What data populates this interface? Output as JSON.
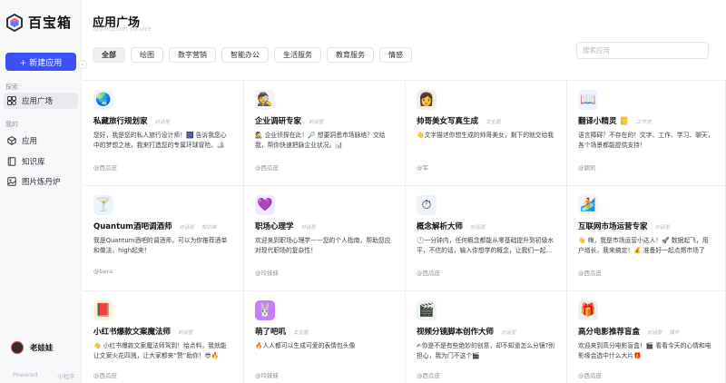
{
  "app": {
    "name": "百宝箱"
  },
  "sidebar": {
    "new_button": "+ 新建应用",
    "explore_label": "探索",
    "my_label": "我的",
    "items": [
      {
        "label": "应用广场",
        "icon": "grid-icon"
      },
      {
        "label": "应用",
        "icon": "box-icon"
      },
      {
        "label": "知识库",
        "icon": "book-icon"
      },
      {
        "label": "图片炼丹炉",
        "icon": "image-icon"
      }
    ],
    "user": {
      "name": "老娃娃"
    },
    "footer": {
      "powered": "Powered",
      "mini": "小程序"
    }
  },
  "header": {
    "title": "应用广场",
    "subtitle": "application square",
    "search_placeholder": "搜索应用",
    "tabs": [
      "全部",
      "绘图",
      "数字营销",
      "智能办公",
      "生活服务",
      "教育服务",
      "情感"
    ]
  },
  "cards": [
    {
      "name": "私藏旅行规划家",
      "tag": "对话型",
      "desc": "您好，我是您的私人旅行设计师！🎆 告诉我您心中的梦想之地，我来打造您的专属环球冒险。🏕✨",
      "author": "@西瓜皮",
      "icon": "globe-icon",
      "glyph": "🌏",
      "bg": "#eef6ff"
    },
    {
      "name": "企业调研专家",
      "tag": "对话型",
      "desc": "🕵 企业侦探在此！🔎 想要洞悉市场脉络？交给我，帮你快速把脉企业状况。📊",
      "author": "@西瓜皮",
      "icon": "detective-icon",
      "glyph": "🕵",
      "bg": "#f4f4f4"
    },
    {
      "name": "帅哥美女写真生成",
      "tag": "文生图",
      "desc": "👋文字描述你想生成的帅哥美女，剩下的就交给我",
      "author": "@军",
      "icon": "portrait-icon",
      "glyph": "👩",
      "bg": "#f6ece6"
    },
    {
      "name": "翻译小精灵 📒",
      "tag": "工作流",
      "desc": "语言障碍？不存在的！文字、工作、学习、聊天，各个场景都能提供支持！",
      "author": "@颖凯",
      "icon": "translate-icon",
      "glyph": "📖",
      "bg": "#eaf3ff"
    },
    {
      "name": "Quantum酒吧调酒师",
      "tag": "对话型",
      "tag2": "知识库",
      "desc": "我是Quantum酒吧的调酒师，可以为你推荐酒单和做法，high起来！",
      "author": "@bera",
      "icon": "cocktail-icon",
      "glyph": "🍸",
      "bg": "#e8f6fb"
    },
    {
      "name": "职场心理学",
      "tag": "对话型",
      "desc": "欢迎来到职场心理学——您的个人指南，帮助您应对现代职场的复杂性！",
      "author": "@玲妹妹",
      "icon": "heart-icon",
      "glyph": "💜",
      "bg": "#efe9ff"
    },
    {
      "name": "概念解析大师",
      "tag": "对话型",
      "desc": "🕛一分钟内，任何概念都能从零基础提升到初级水平，不信的话，输入你想学的概念，让我们一起...",
      "author": "@西瓜皮",
      "icon": "stopwatch-icon",
      "glyph": "⏱",
      "bg": "#eef3f8"
    },
    {
      "name": "互联网市场运营专家",
      "tag": "对话型",
      "desc": "👋 嗨，我是市场运营小达人！🚀 数据起飞，用户增长，我来搞定！💰 准备好一起点燃市场了吗？🔥",
      "author": "@西瓜皮",
      "icon": "surfer-icon",
      "glyph": "🏄",
      "bg": "#ffeef2"
    },
    {
      "name": "小红书爆款文案魔法师",
      "tag": "对话型",
      "desc": "👋 小红书爆款文案魔法师驾到！给点料，我就能让文案火花四溅，让大家都来“赞”助你！😎🔥",
      "author": "@西瓜皮",
      "icon": "book-spell-icon",
      "glyph": "📕",
      "bg": "#fff3d6"
    },
    {
      "name": "萌了吧叽",
      "tag": "文生图",
      "desc": "🔥人人都可以生成可爱的表情包头像",
      "author": "@玲妹妹",
      "icon": "cute-face-icon",
      "glyph": "🐰",
      "bg": "#c77dff"
    },
    {
      "name": "视频分镜脚本创作大师",
      "tag": "对话型",
      "desc": "✍你是不是有些绝妙的创意，却不知道怎么分镜?别担心，我为门不这个🎬",
      "author": "@西瓜皮",
      "icon": "film-icon",
      "glyph": "🎬",
      "bg": "#eaf7ea"
    },
    {
      "name": "高分电影推荐盲盒",
      "tag": "对话型",
      "tag2": "插件",
      "desc": "欢迎来到高分电影盲盒！🎬 看看今天的心情和电影缘会选中什么大片🎁",
      "author": "@西瓜皮",
      "icon": "gift-icon",
      "glyph": "🎁",
      "bg": "#f1eef7"
    }
  ]
}
